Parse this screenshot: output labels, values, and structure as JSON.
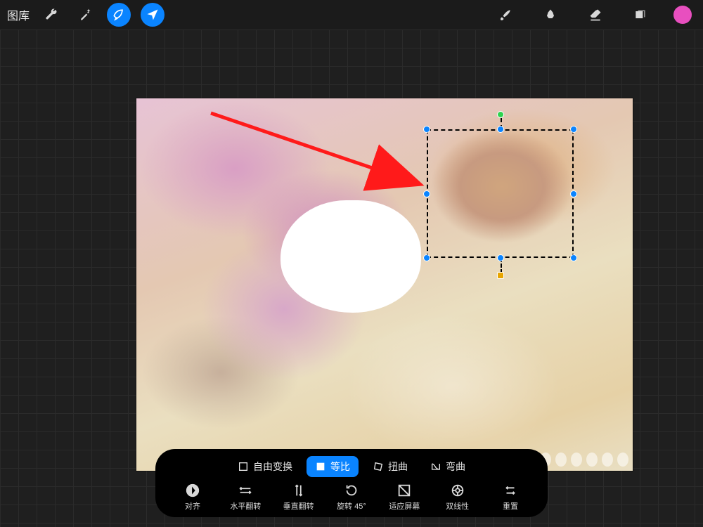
{
  "top": {
    "gallery_label": "图库",
    "icons": {
      "wrench": "wrench-icon",
      "wand": "wand-icon",
      "select": "select-icon",
      "move": "move-icon",
      "brush": "brush-icon",
      "smudge": "smudge-icon",
      "eraser": "eraser-icon",
      "layers": "layers-icon",
      "color": "color-swatch"
    }
  },
  "transform": {
    "modes": [
      {
        "label": "自由变换",
        "active": false
      },
      {
        "label": "等比",
        "active": true
      },
      {
        "label": "扭曲",
        "active": false
      },
      {
        "label": "弯曲",
        "active": false
      }
    ],
    "actions": [
      {
        "label": "对齐"
      },
      {
        "label": "水平翻转"
      },
      {
        "label": "垂直翻转"
      },
      {
        "label": "旋转 45°"
      },
      {
        "label": "适应屏幕"
      },
      {
        "label": "双线性"
      },
      {
        "label": "重置"
      }
    ]
  }
}
